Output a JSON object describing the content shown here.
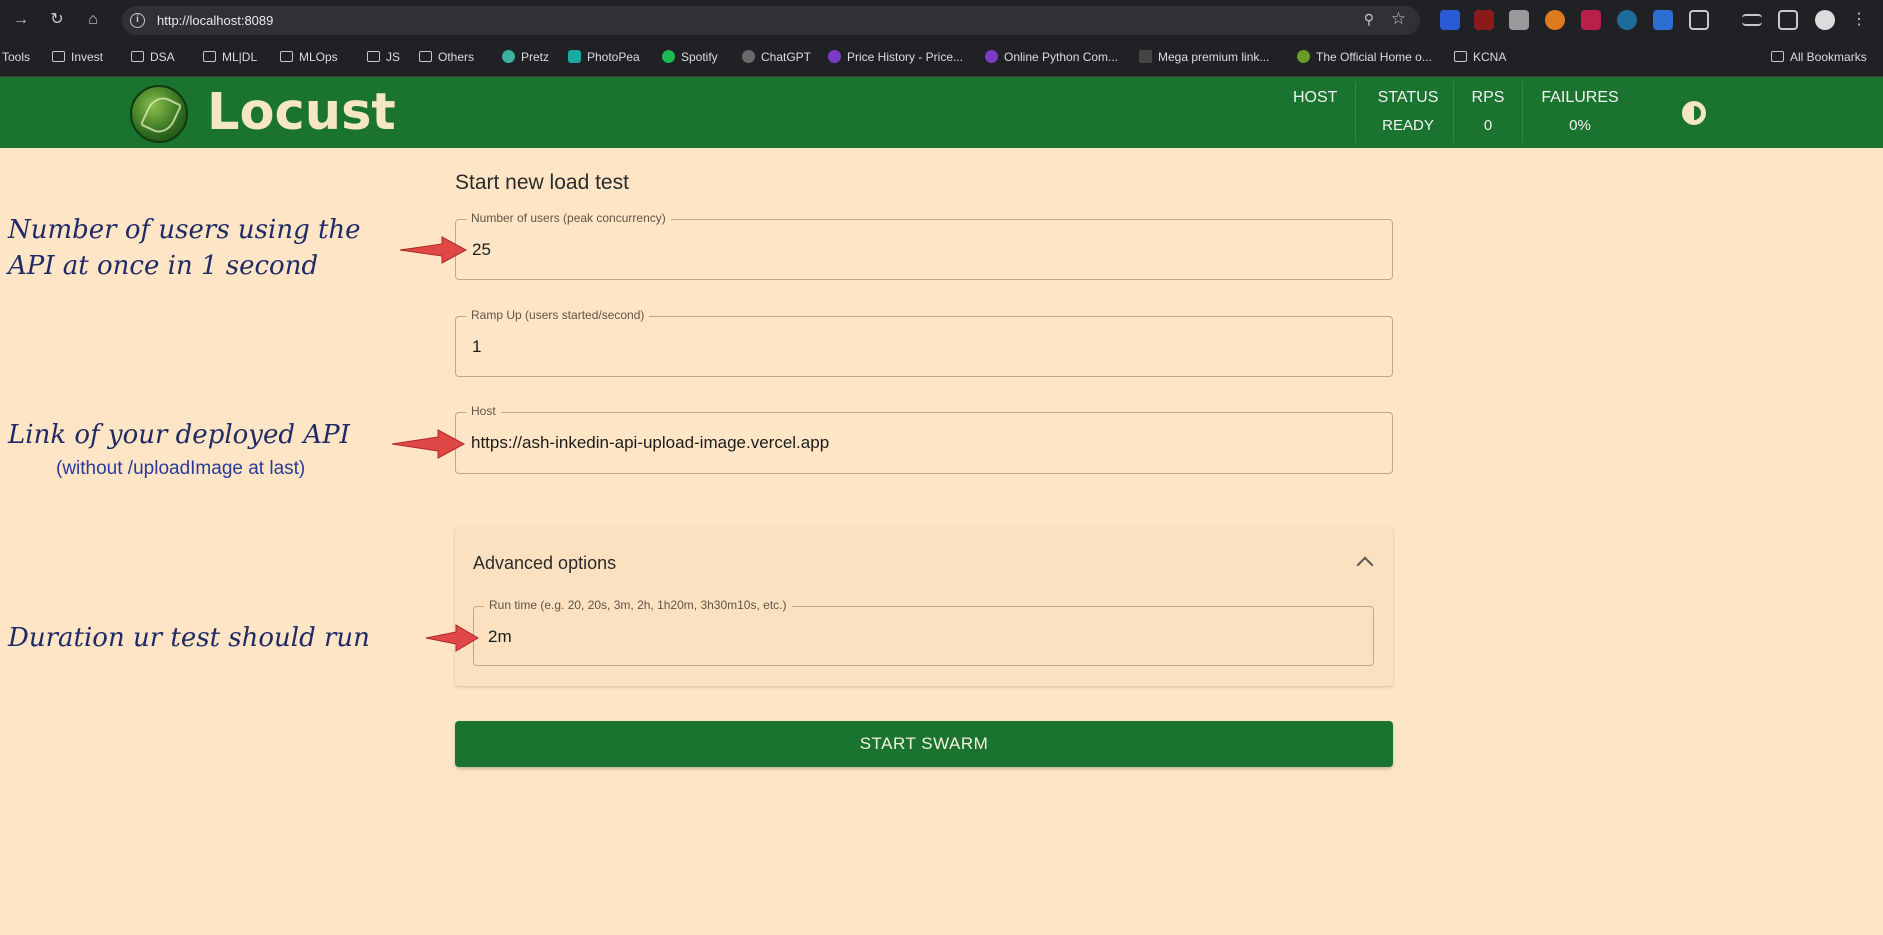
{
  "browser": {
    "url": "http://localhost:8089",
    "bookmarks": [
      "Tools",
      "Invest",
      "DSA",
      "ML|DL",
      "MLOps",
      "JS",
      "Others",
      "Pretz",
      "PhotoPea",
      "Spotify",
      "ChatGPT",
      "Price History - Price...",
      "Online Python Com...",
      "Mega premium link...",
      "The Official Home o...",
      "KCNA"
    ],
    "all_bookmarks": "All Bookmarks"
  },
  "header": {
    "brand": "Locust",
    "stats": [
      {
        "label": "HOST",
        "value": ""
      },
      {
        "label": "STATUS",
        "value": "READY"
      },
      {
        "label": "RPS",
        "value": "0"
      },
      {
        "label": "FAILURES",
        "value": "0%"
      }
    ]
  },
  "form": {
    "title": "Start new load test",
    "users": {
      "label": "Number of users (peak concurrency)",
      "value": "25"
    },
    "ramp_up": {
      "label": "Ramp Up (users started/second)",
      "value": "1"
    },
    "host": {
      "label": "Host",
      "value": "https://ash-inkedin-api-upload-image.vercel.app"
    },
    "advanced": {
      "title": "Advanced options",
      "run_time": {
        "label": "Run time (e.g. 20, 20s, 3m, 2h, 1h20m, 3h30m10s, etc.)",
        "value": "2m"
      }
    },
    "start_button": "START SWARM"
  },
  "annotations": {
    "users": [
      "Number of users using the",
      "API at once in 1 second"
    ],
    "host": "Link of your deployed API",
    "host_sub": "(without /uploadImage at last)",
    "run_time": "Duration ur test should run",
    "arrow_color": "#e04848"
  }
}
